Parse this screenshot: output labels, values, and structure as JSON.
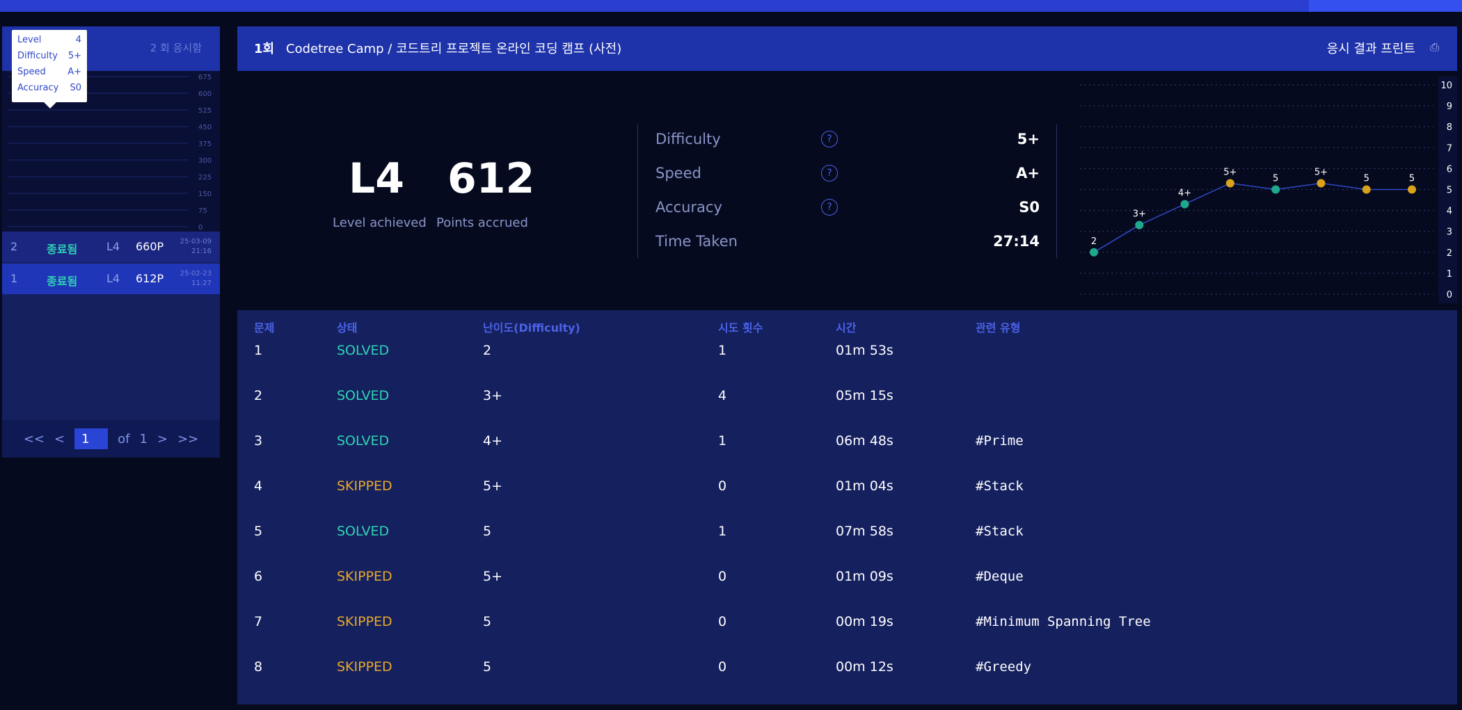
{
  "sidebar": {
    "count_text": "2 회 응시함",
    "tooltip": [
      {
        "k": "Level",
        "v": "4"
      },
      {
        "k": "Difficulty",
        "v": "5+"
      },
      {
        "k": "Speed",
        "v": "A+"
      },
      {
        "k": "Accuracy",
        "v": "S0"
      }
    ],
    "y_ticks": [
      "675",
      "600",
      "525",
      "450",
      "375",
      "300",
      "225",
      "150",
      "75",
      "0"
    ],
    "history": [
      {
        "idx": "2",
        "status": "종료됨",
        "level": "L4",
        "points": "660P",
        "date": "25-03-09",
        "time": "21:16"
      },
      {
        "idx": "1",
        "status": "종료됨",
        "level": "L4",
        "points": "612P",
        "date": "25-02-23",
        "time": "11:27"
      }
    ],
    "pager": {
      "first": "<<",
      "prev": "<",
      "page": "1",
      "of": "of",
      "total": "1",
      "next": ">",
      "last": ">>"
    }
  },
  "header": {
    "num": "1회",
    "title": "Codetree Camp / 코드트리 프로젝트 온라인 코딩 캠프 (사전)",
    "print": "응시 결과 프린트",
    "print_icon": "printer-icon"
  },
  "summary": {
    "level": "L4",
    "level_caption": "Level achieved",
    "points": "612",
    "points_caption": "Points accrued",
    "stats": [
      {
        "label": "Difficulty",
        "value": "5+"
      },
      {
        "label": "Speed",
        "value": "A+"
      },
      {
        "label": "Accuracy",
        "value": "S0"
      },
      {
        "label": "Time Taken",
        "value": "27:14"
      }
    ]
  },
  "chart_data": {
    "type": "line",
    "y_ticks": [
      "10",
      "9",
      "8",
      "7",
      "6",
      "5",
      "4",
      "3",
      "2",
      "1",
      "0"
    ],
    "ylim": [
      0,
      10
    ],
    "grid": true,
    "points": [
      {
        "label": "2",
        "value": 2,
        "status": "solved"
      },
      {
        "label": "3+",
        "value": 3.3,
        "status": "solved"
      },
      {
        "label": "4+",
        "value": 4.3,
        "status": "solved"
      },
      {
        "label": "5+",
        "value": 5.3,
        "status": "skipped"
      },
      {
        "label": "5",
        "value": 5,
        "status": "solved"
      },
      {
        "label": "5+",
        "value": 5.3,
        "status": "skipped"
      },
      {
        "label": "5",
        "value": 5,
        "status": "skipped"
      },
      {
        "label": "5",
        "value": 5,
        "status": "skipped"
      }
    ],
    "colors": {
      "solved": "#1fa88c",
      "skipped": "#d9a21b",
      "line": "#3048c8"
    }
  },
  "table": {
    "headers": [
      "문제",
      "상태",
      "난이도(Difficulty)",
      "시도 횟수",
      "시간",
      "관련 유형"
    ],
    "rows": [
      {
        "no": "1",
        "status": "SOLVED",
        "diff": "2",
        "tries": "1",
        "time": "01m 53s",
        "tag": ""
      },
      {
        "no": "2",
        "status": "SOLVED",
        "diff": "3+",
        "tries": "4",
        "time": "05m 15s",
        "tag": ""
      },
      {
        "no": "3",
        "status": "SOLVED",
        "diff": "4+",
        "tries": "1",
        "time": "06m 48s",
        "tag": "#Prime"
      },
      {
        "no": "4",
        "status": "SKIPPED",
        "diff": "5+",
        "tries": "0",
        "time": "01m 04s",
        "tag": "#Stack"
      },
      {
        "no": "5",
        "status": "SOLVED",
        "diff": "5",
        "tries": "1",
        "time": "07m 58s",
        "tag": "#Stack"
      },
      {
        "no": "6",
        "status": "SKIPPED",
        "diff": "5+",
        "tries": "0",
        "time": "01m 09s",
        "tag": "#Deque"
      },
      {
        "no": "7",
        "status": "SKIPPED",
        "diff": "5",
        "tries": "0",
        "time": "00m 19s",
        "tag": "#Minimum Spanning Tree"
      },
      {
        "no": "8",
        "status": "SKIPPED",
        "diff": "5",
        "tries": "0",
        "time": "00m 12s",
        "tag": "#Greedy"
      }
    ]
  }
}
